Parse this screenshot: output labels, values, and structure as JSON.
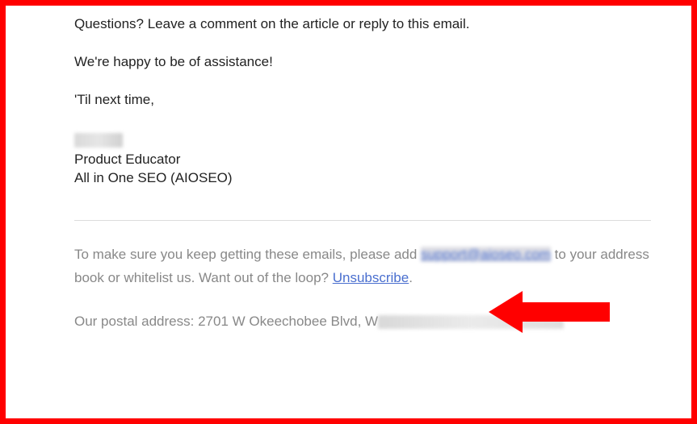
{
  "body": {
    "p1": "Questions? Leave a comment on the article or reply to this email.",
    "p2": "We're happy to be of assistance!",
    "p3": "'Til next time,"
  },
  "signature": {
    "title": "Product Educator",
    "company": "All in One SEO (AIOSEO)"
  },
  "footer": {
    "pre_email": "To make sure you keep getting these emails, please add ",
    "support_email": "support@aioseo.com",
    "post_email": " to your address book or whitelist us. Want out of the loop? ",
    "unsubscribe": "Unsubscribe",
    "period": ".",
    "postal_prefix": "Our postal address: 2701 W Okeechobee Blvd, W"
  }
}
